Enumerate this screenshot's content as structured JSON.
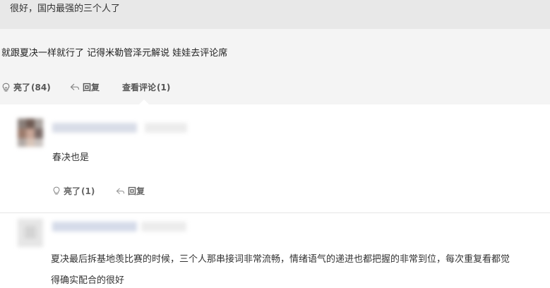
{
  "top_quote": {
    "text": "很好，国内最强的三个人了"
  },
  "answer": {
    "text": "就跟夏决一样就行了 记得米勒管泽元解说 娃娃去评论席",
    "actions": {
      "like_label": "亮了",
      "like_count": "(84)",
      "reply_label": "回复",
      "view_comments_label": "查看评论",
      "view_comments_count": "(1)"
    }
  },
  "comments": [
    {
      "text": "春决也是",
      "like_label": "亮了",
      "like_count": "(1)",
      "reply_label": "回复"
    },
    {
      "text_line1": "夏决最后拆基地羡比赛的时候，三个人那串接词非常流畅，情绪语气的递进也都把握的非常到位，每次重复看都觉",
      "text_line2": "得确实配合的很好"
    }
  ],
  "colors": {
    "quote_bg": "#e8e8e8",
    "section_bg": "#f4f4f4",
    "text": "#333333",
    "action_text": "#555555"
  }
}
